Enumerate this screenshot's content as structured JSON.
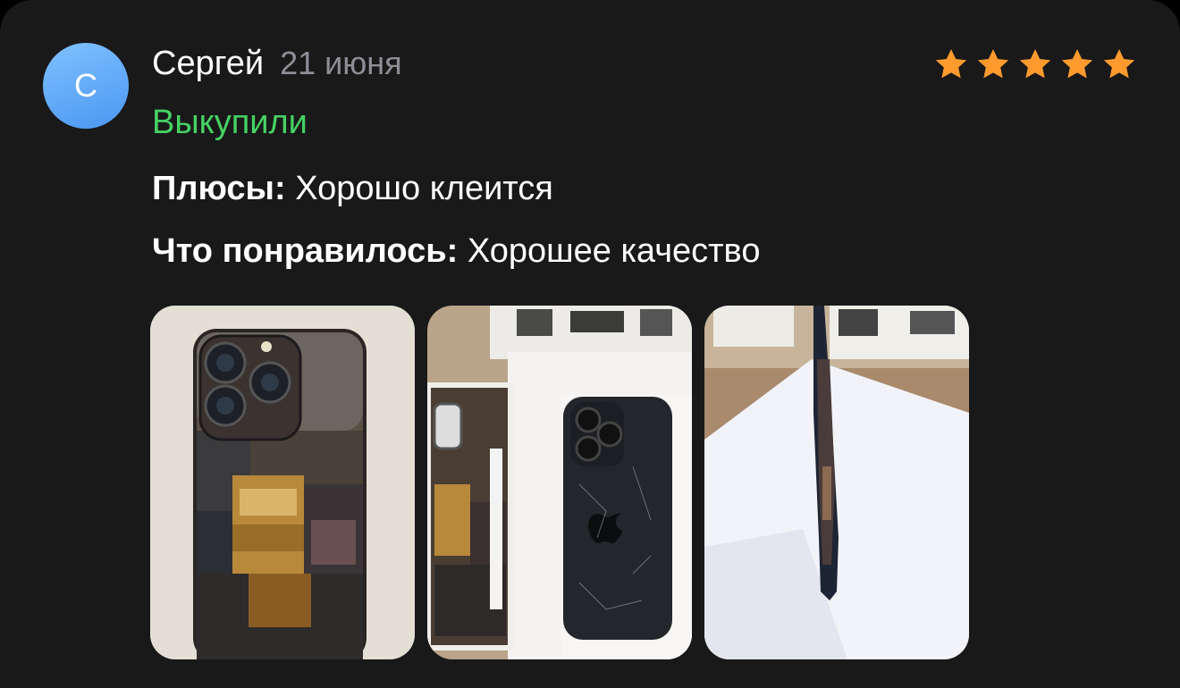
{
  "review": {
    "avatar_letter": "С",
    "author": "Сергей",
    "date": "21 июня",
    "rating": 5,
    "status": "Выкупили",
    "pros_label": "Плюсы:",
    "pros_text": "Хорошо клеится",
    "liked_label": "Что понравилось:",
    "liked_text": "Хорошее качество"
  },
  "icons": {
    "star": "star-icon"
  },
  "colors": {
    "background": "#19191a",
    "star": "#ff9a2e",
    "status": "#46d164",
    "date": "#8e8e96",
    "avatar": "#5aa4f5"
  },
  "photos": [
    {
      "name": "photo-phone-with-skin-back"
    },
    {
      "name": "photo-phone-and-skin-sheet"
    },
    {
      "name": "photo-phone-side-view"
    }
  ]
}
